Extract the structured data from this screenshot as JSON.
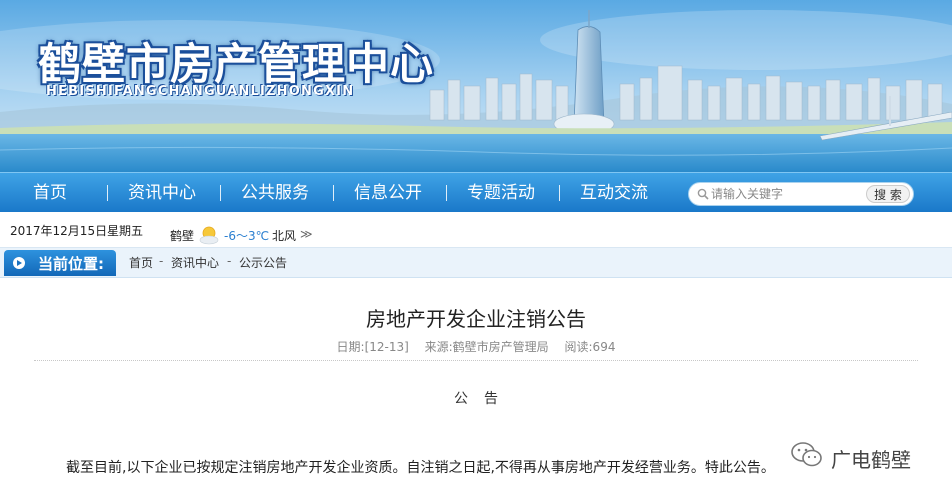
{
  "site": {
    "title": "鹤壁市房产管理中心",
    "pinyin": "HEBISHIFANGCHANGUANLIZHONGXIN"
  },
  "nav": {
    "items": [
      "首页",
      "资讯中心",
      "公共服务",
      "信息公开",
      "专题活动",
      "互动交流"
    ],
    "search_placeholder": "请输入关键字",
    "search_button": "搜 索"
  },
  "infobar": {
    "date": "2017年12月15日",
    "weekday": "星期五",
    "city": "鹤壁",
    "weather_icon": "sun-cloud-icon",
    "temperature": "-6～3℃",
    "wind": "北风",
    "more": "≫"
  },
  "breadcrumb": {
    "label": "当前位置:",
    "home": "首页",
    "sep": "-",
    "section": "资讯中心",
    "page": "公示公告"
  },
  "article": {
    "title": "房地产开发企业注销公告",
    "date": "日期:[12-13]",
    "source": "来源:鹤壁市房产管理局",
    "views": "阅读:694",
    "heading": "公告",
    "body": "截至目前,以下企业已按规定注销房地产开发企业资质。自注销之日起,不得再从事房地产开发经营业务。特此公告。"
  },
  "watermark": {
    "text": "广电鹤壁"
  },
  "colors": {
    "nav_blue": "#1a78c9",
    "breadcrumb_bg": "#eaf3fb",
    "temperature": "#2b7fd0"
  }
}
